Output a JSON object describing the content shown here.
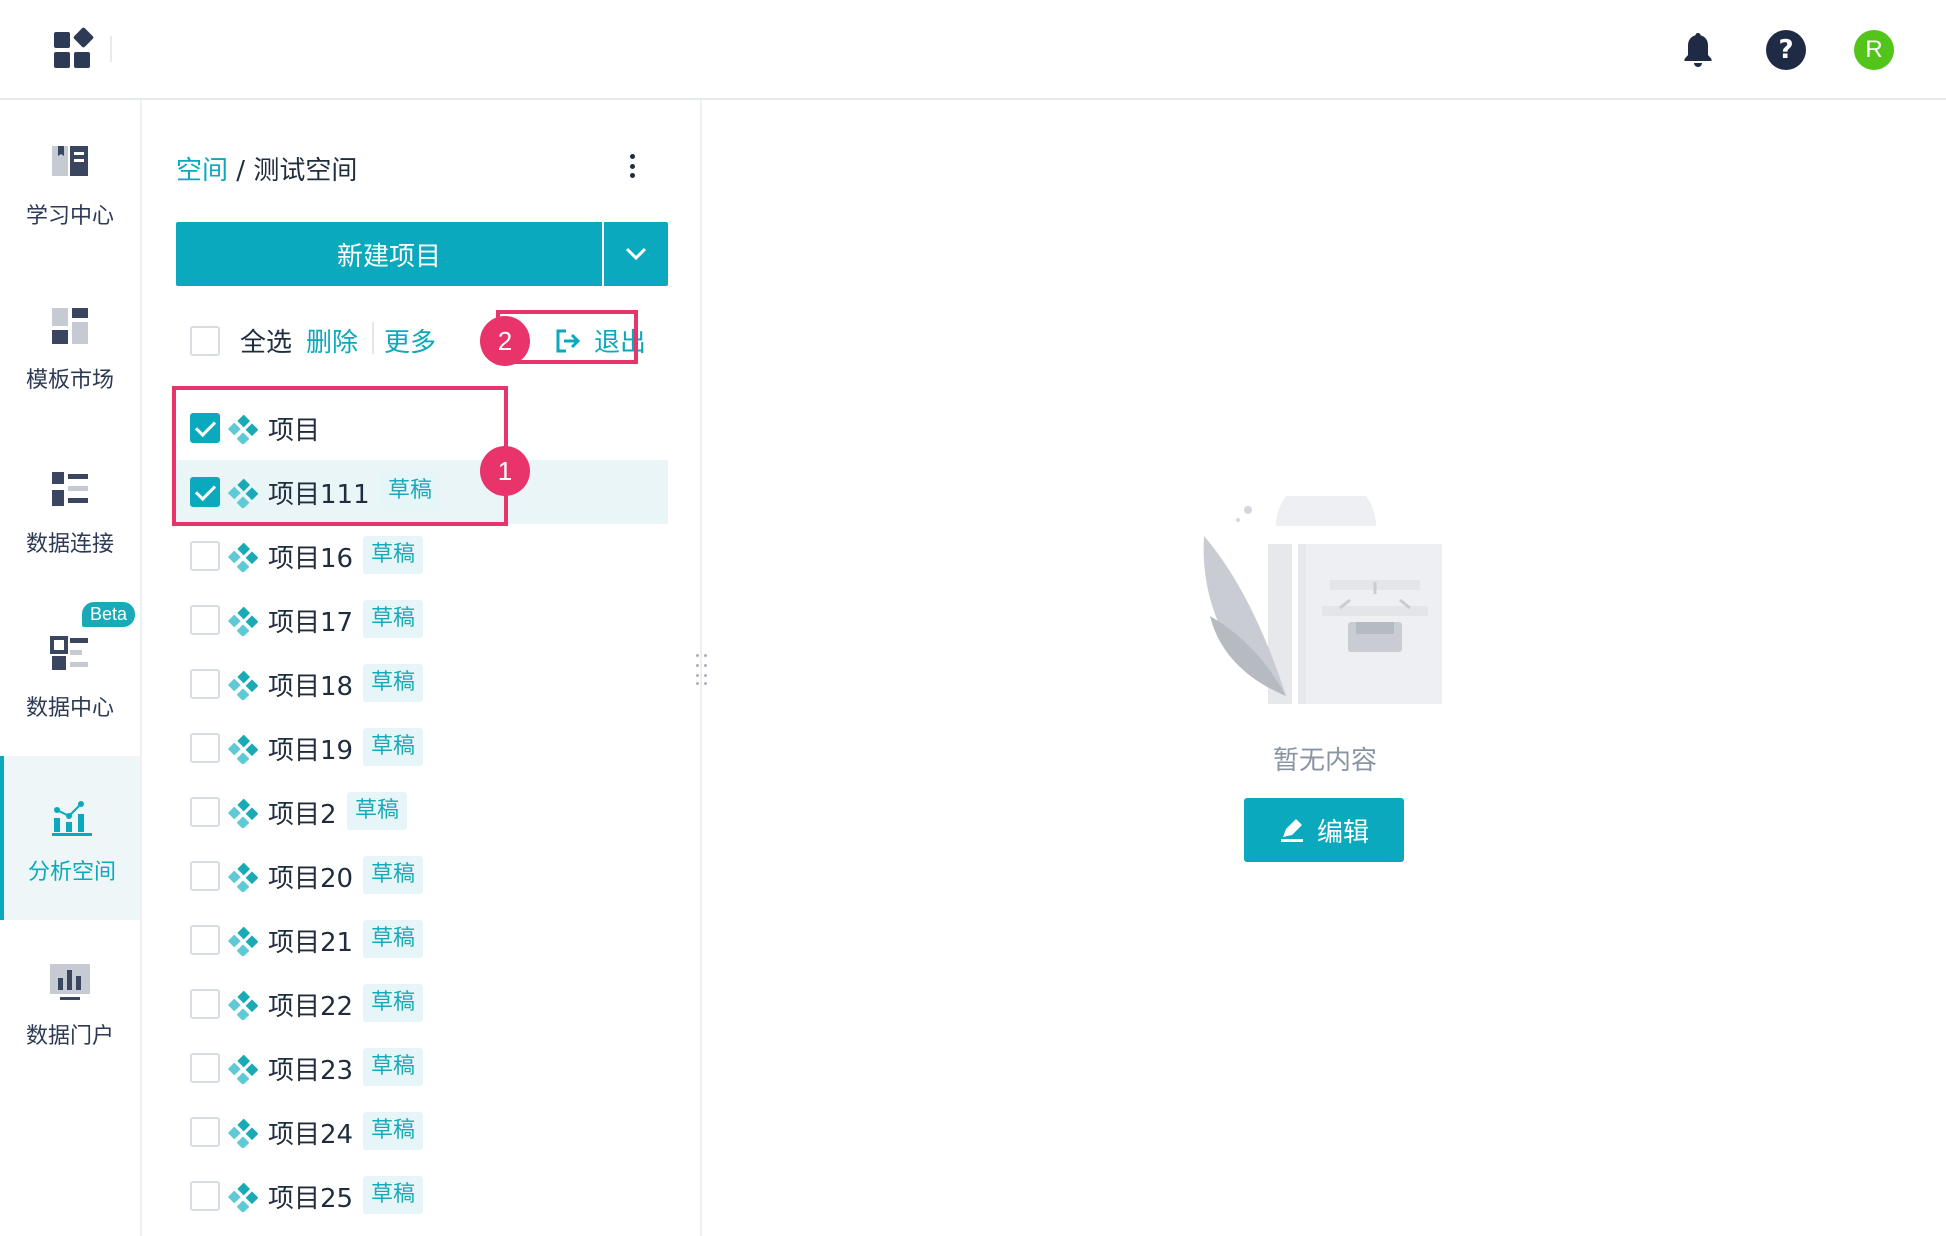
{
  "header": {
    "avatar_initial": "R",
    "help_symbol": "?"
  },
  "nav": {
    "items": [
      {
        "label": "学习中心",
        "icon": "book-icon"
      },
      {
        "label": "模板市场",
        "icon": "template-icon"
      },
      {
        "label": "数据连接",
        "icon": "data-connect-icon"
      },
      {
        "label": "数据中心",
        "icon": "data-center-icon",
        "badge": "Beta"
      },
      {
        "label": "分析空间",
        "icon": "analysis-icon",
        "active": true
      },
      {
        "label": "数据门户",
        "icon": "portal-icon"
      }
    ]
  },
  "panel": {
    "breadcrumb_link": "空间",
    "breadcrumb_sep": " / ",
    "breadcrumb_current": "测试空间",
    "new_project_label": "新建项目",
    "select_all_label": "全选",
    "delete_label": "删除",
    "more_label": "更多",
    "exit_label": "退出",
    "projects": [
      {
        "name": "项目",
        "checked": true,
        "tag": ""
      },
      {
        "name": "项目111",
        "checked": true,
        "tag": "草稿"
      },
      {
        "name": "项目16",
        "checked": false,
        "tag": "草稿"
      },
      {
        "name": "项目17",
        "checked": false,
        "tag": "草稿"
      },
      {
        "name": "项目18",
        "checked": false,
        "tag": "草稿"
      },
      {
        "name": "项目19",
        "checked": false,
        "tag": "草稿"
      },
      {
        "name": "项目2",
        "checked": false,
        "tag": "草稿"
      },
      {
        "name": "项目20",
        "checked": false,
        "tag": "草稿"
      },
      {
        "name": "项目21",
        "checked": false,
        "tag": "草稿"
      },
      {
        "name": "项目22",
        "checked": false,
        "tag": "草稿"
      },
      {
        "name": "项目23",
        "checked": false,
        "tag": "草稿"
      },
      {
        "name": "项目24",
        "checked": false,
        "tag": "草稿"
      },
      {
        "name": "项目25",
        "checked": false,
        "tag": "草稿"
      }
    ]
  },
  "annotations": {
    "badge1": "1",
    "badge2": "2"
  },
  "empty_state": {
    "text": "暂无内容",
    "edit_label": "编辑"
  },
  "colors": {
    "accent": "#0aa9bd",
    "highlight": "#e8336b",
    "avatar": "#52c41a"
  }
}
